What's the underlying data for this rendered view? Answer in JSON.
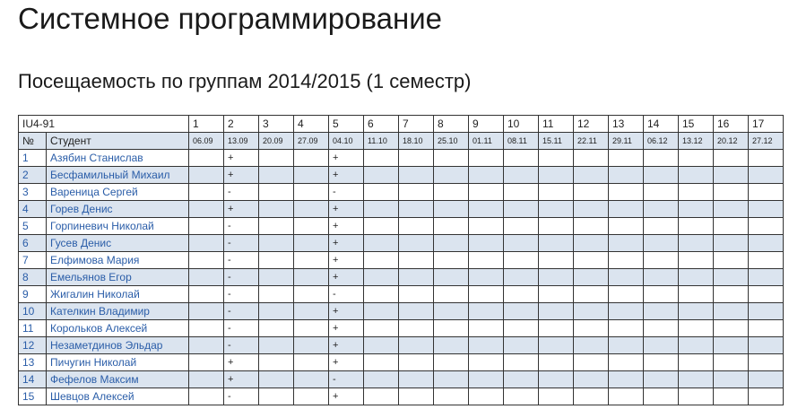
{
  "page_title": "Системное программирование",
  "section_title": "Посещаемость по группам 2014/2015 (1 семестр)",
  "table": {
    "group": "IU4-91",
    "num_header": "№",
    "student_header": "Студент",
    "lessons": [
      "1",
      "2",
      "3",
      "4",
      "5",
      "6",
      "7",
      "8",
      "9",
      "10",
      "11",
      "12",
      "13",
      "14",
      "15",
      "16",
      "17"
    ],
    "dates": [
      "06.09",
      "13.09",
      "20.09",
      "27.09",
      "04.10",
      "11.10",
      "18.10",
      "25.10",
      "01.11",
      "08.11",
      "15.11",
      "22.11",
      "29.11",
      "06.12",
      "13.12",
      "20.12",
      "27.12"
    ],
    "students": [
      {
        "n": "1",
        "name": "Азябин Станислав",
        "marks": [
          "",
          "+",
          "",
          "",
          "+",
          "",
          "",
          "",
          "",
          "",
          "",
          "",
          "",
          "",
          "",
          "",
          ""
        ]
      },
      {
        "n": "2",
        "name": "Бесфамильный Михаил",
        "marks": [
          "",
          "+",
          "",
          "",
          "+",
          "",
          "",
          "",
          "",
          "",
          "",
          "",
          "",
          "",
          "",
          "",
          ""
        ]
      },
      {
        "n": "3",
        "name": "Вареница Сергей",
        "marks": [
          "",
          "-",
          "",
          "",
          "-",
          "",
          "",
          "",
          "",
          "",
          "",
          "",
          "",
          "",
          "",
          "",
          ""
        ]
      },
      {
        "n": "4",
        "name": "Горев Денис",
        "marks": [
          "",
          "+",
          "",
          "",
          "+",
          "",
          "",
          "",
          "",
          "",
          "",
          "",
          "",
          "",
          "",
          "",
          ""
        ]
      },
      {
        "n": "5",
        "name": "Горпиневич Николай",
        "marks": [
          "",
          "-",
          "",
          "",
          "+",
          "",
          "",
          "",
          "",
          "",
          "",
          "",
          "",
          "",
          "",
          "",
          ""
        ]
      },
      {
        "n": "6",
        "name": "Гусев Денис",
        "marks": [
          "",
          "-",
          "",
          "",
          "+",
          "",
          "",
          "",
          "",
          "",
          "",
          "",
          "",
          "",
          "",
          "",
          ""
        ]
      },
      {
        "n": "7",
        "name": "Елфимова Мария",
        "marks": [
          "",
          "-",
          "",
          "",
          "+",
          "",
          "",
          "",
          "",
          "",
          "",
          "",
          "",
          "",
          "",
          "",
          ""
        ]
      },
      {
        "n": "8",
        "name": "Емельянов Егор",
        "marks": [
          "",
          "-",
          "",
          "",
          "+",
          "",
          "",
          "",
          "",
          "",
          "",
          "",
          "",
          "",
          "",
          "",
          ""
        ]
      },
      {
        "n": "9",
        "name": "Жигалин Николай",
        "marks": [
          "",
          "-",
          "",
          "",
          "-",
          "",
          "",
          "",
          "",
          "",
          "",
          "",
          "",
          "",
          "",
          "",
          ""
        ]
      },
      {
        "n": "10",
        "name": "Кателкин Владимир",
        "marks": [
          "",
          "-",
          "",
          "",
          "+",
          "",
          "",
          "",
          "",
          "",
          "",
          "",
          "",
          "",
          "",
          "",
          ""
        ]
      },
      {
        "n": "11",
        "name": "Корольков Алексей",
        "marks": [
          "",
          "-",
          "",
          "",
          "+",
          "",
          "",
          "",
          "",
          "",
          "",
          "",
          "",
          "",
          "",
          "",
          ""
        ]
      },
      {
        "n": "12",
        "name": "Незаметдинов Эльдар",
        "marks": [
          "",
          "-",
          "",
          "",
          "+",
          "",
          "",
          "",
          "",
          "",
          "",
          "",
          "",
          "",
          "",
          "",
          ""
        ]
      },
      {
        "n": "13",
        "name": "Пичугин Николай",
        "marks": [
          "",
          "+",
          "",
          "",
          "+",
          "",
          "",
          "",
          "",
          "",
          "",
          "",
          "",
          "",
          "",
          "",
          ""
        ]
      },
      {
        "n": "14",
        "name": "Фефелов Максим",
        "marks": [
          "",
          "+",
          "",
          "",
          "-",
          "",
          "",
          "",
          "",
          "",
          "",
          "",
          "",
          "",
          "",
          "",
          ""
        ]
      },
      {
        "n": "15",
        "name": "Шевцов Алексей",
        "marks": [
          "",
          "-",
          "",
          "",
          "+",
          "",
          "",
          "",
          "",
          "",
          "",
          "",
          "",
          "",
          "",
          "",
          ""
        ]
      }
    ]
  }
}
